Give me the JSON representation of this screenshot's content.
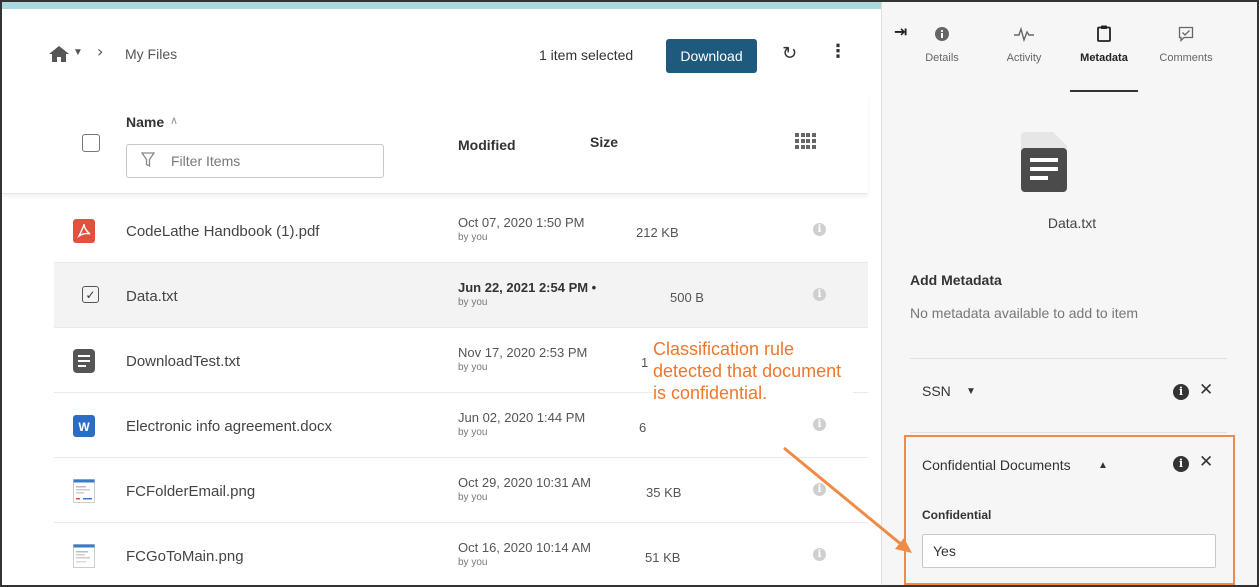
{
  "toolbar": {
    "breadcrumb_current": "My Files",
    "selection_text": "1 item selected",
    "download_label": "Download"
  },
  "table": {
    "col_name": "Name",
    "col_modified": "Modified",
    "col_size": "Size",
    "filter_placeholder": "Filter Items",
    "rows": [
      {
        "name": "CodeLathe Handbook (1).pdf",
        "modified": "Oct 07, 2020 1:50 PM",
        "by": "by you",
        "size": "212 KB",
        "icon": "pdf-icon",
        "selected": false
      },
      {
        "name": "Data.txt",
        "modified": "Jun 22, 2021 2:54 PM •",
        "by": "by you",
        "size": "500 B",
        "icon": "checkbox-checked-icon",
        "selected": true
      },
      {
        "name": "DownloadTest.txt",
        "modified": "Nov 17, 2020 2:53 PM",
        "by": "by you",
        "size": "1",
        "icon": "text-file-icon",
        "selected": false
      },
      {
        "name": "Electronic info agreement.docx",
        "modified": "Jun 02, 2020 1:44 PM",
        "by": "by you",
        "size": "6",
        "icon": "word-icon",
        "selected": false
      },
      {
        "name": "FCFolderEmail.png",
        "modified": "Oct 29, 2020 10:31 AM",
        "by": "by you",
        "size": "35 KB",
        "icon": "image-thumbnail-icon",
        "selected": false
      },
      {
        "name": "FCGoToMain.png",
        "modified": "Oct 16, 2020 10:14 AM",
        "by": "by you",
        "size": "51 KB",
        "icon": "image-thumbnail-icon",
        "selected": false
      }
    ]
  },
  "panel": {
    "tabs": [
      {
        "label": "Details",
        "icon": "info-icon"
      },
      {
        "label": "Activity",
        "icon": "activity-icon"
      },
      {
        "label": "Metadata",
        "icon": "clipboard-icon"
      },
      {
        "label": "Comments",
        "icon": "comment-icon"
      }
    ],
    "active_tab": "Metadata",
    "file_name": "Data.txt",
    "add_metadata_title": "Add Metadata",
    "add_metadata_sub": "No metadata available to add to item",
    "ssn_label": "SSN",
    "confidential_title": "Confidential Documents",
    "field_label": "Confidential",
    "field_value": "Yes"
  },
  "annotation": {
    "text": "Classification rule detected that document is confidential.",
    "color": "#f0762a"
  },
  "colors": {
    "accent_bar": "#a9d8de",
    "download_button": "#1e5a7e",
    "highlight_border": "#f08a45"
  }
}
